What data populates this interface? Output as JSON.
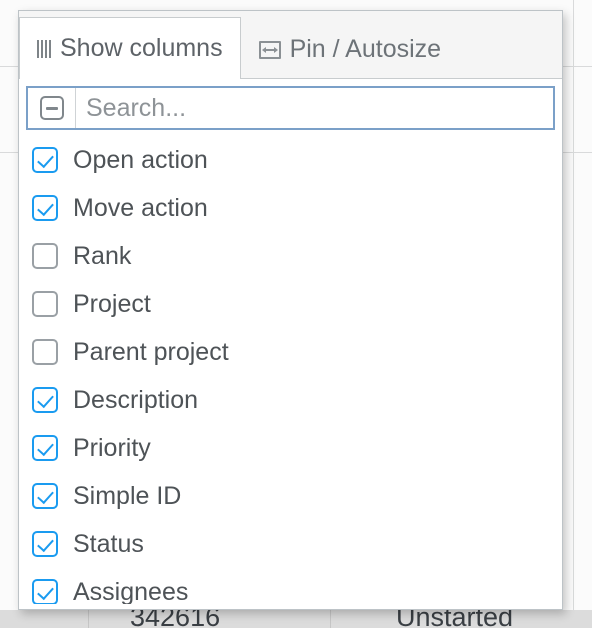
{
  "background": {
    "cells": [
      {
        "text": "342616",
        "align": "center"
      },
      {
        "text": "Unstarted",
        "align": "center"
      }
    ]
  },
  "popup": {
    "tabs": [
      {
        "label": "Show columns",
        "icon": "columns-icon",
        "active": true
      },
      {
        "label": "Pin / Autosize",
        "icon": "autosize-icon",
        "active": false
      }
    ],
    "search": {
      "placeholder": "Search...",
      "value": "",
      "toggle_state": "indeterminate",
      "toggle_icon": "minus-square-icon"
    },
    "columns": [
      {
        "label": "Open action",
        "checked": true
      },
      {
        "label": "Move action",
        "checked": true
      },
      {
        "label": "Rank",
        "checked": false
      },
      {
        "label": "Project",
        "checked": false
      },
      {
        "label": "Parent project",
        "checked": false
      },
      {
        "label": "Description",
        "checked": true
      },
      {
        "label": "Priority",
        "checked": true
      },
      {
        "label": "Simple ID",
        "checked": true
      },
      {
        "label": "Status",
        "checked": true
      },
      {
        "label": "Assignees",
        "checked": true
      }
    ]
  },
  "colors": {
    "accent": "#1a9bf0",
    "focus_border": "#7ba0c8",
    "text": "#4e5357",
    "muted": "#8e9397",
    "panel_border": "#bdc3c7"
  }
}
